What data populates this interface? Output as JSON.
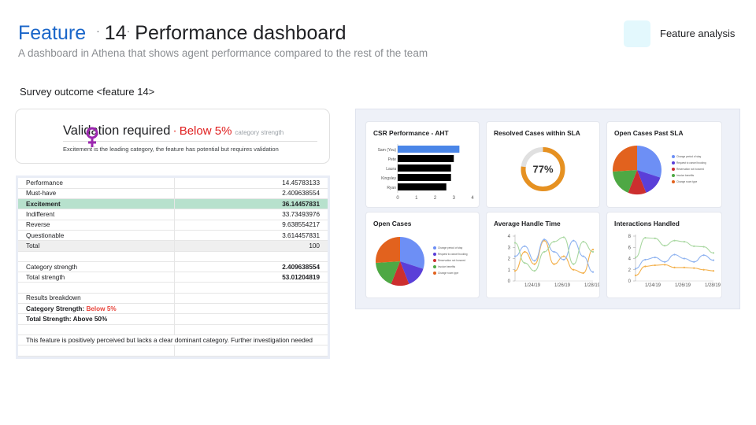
{
  "header": {
    "title_feature": "Feature",
    "title_sep": "·",
    "title_number": "14",
    "title_sep2": "·",
    "title_rest": "Performance dashboard",
    "subtitle": "A dashboard in Athena that shows agent performance compared to the rest of the team"
  },
  "tag": {
    "label": "Feature analysis",
    "color": "#e3f8fd"
  },
  "section_label": "Survey outcome <feature 14>",
  "validation": {
    "heading": "Validation required",
    "dot": "·",
    "below": "Below 5%",
    "small": "category strength",
    "description": "Excitement is the leading category, the feature has potential but requires validation",
    "icon": "female-symbol-icon",
    "icon_color": "#9c27b0"
  },
  "sheet": {
    "rows": [
      {
        "label": "Performance",
        "value": "14.45783133"
      },
      {
        "label": "Must-have",
        "value": "2.409638554"
      },
      {
        "label": "Excitement",
        "value": "36.14457831",
        "highlight": true
      },
      {
        "label": "Indifferent",
        "value": "33.73493976"
      },
      {
        "label": "Reverse",
        "value": "9.638554217"
      },
      {
        "label": "Questionable",
        "value": "3.614457831"
      },
      {
        "label": "Total",
        "value": "100",
        "total": true
      },
      {
        "label": "",
        "value": ""
      },
      {
        "label": "Category strength",
        "value": "2.409638554",
        "bold_value": true
      },
      {
        "label": "Total strength",
        "value": "53.01204819",
        "bold_value": true
      },
      {
        "label": "",
        "value": ""
      },
      {
        "label": "Results breakdown",
        "value": ""
      },
      {
        "label": "Category Strength: ",
        "label_red": "Below 5%",
        "value": "",
        "bold": true
      },
      {
        "label": "Total Strength: Above 50%",
        "value": "",
        "bold": true
      },
      {
        "label": "",
        "value": ""
      },
      {
        "label": "This feature is positively perceived but lacks a clear dominant category. Further investigation needed",
        "value": "",
        "full": true
      },
      {
        "label": "",
        "value": ""
      }
    ]
  },
  "dashboard": {
    "cards": [
      {
        "title": "CSR Performance - AHT"
      },
      {
        "title": "Resolved Cases within SLA"
      },
      {
        "title": "Open Cases Past SLA"
      },
      {
        "title": "Open Cases"
      },
      {
        "title": "Average Handle Time"
      },
      {
        "title": "Interactions Handled"
      }
    ],
    "aht": {
      "agents": [
        "Sam (You)",
        "Pete",
        "Laura",
        "Kingsley",
        "Ryan"
      ],
      "values": [
        3.3,
        3.0,
        2.85,
        2.85,
        2.6
      ],
      "ticks": [
        "0",
        "1",
        "2",
        "3",
        "4"
      ],
      "max": 4,
      "colors": [
        "#4a86e8",
        "#000000",
        "#000000",
        "#000000",
        "#000000"
      ]
    },
    "sla": {
      "percent": 77,
      "label": "77%",
      "color": "#e69121",
      "track": "#e0e0e0"
    },
    "pie_legend": [
      "Change period of stay",
      "Request to cancel booking",
      "Reservation not honored",
      "Invoice benefits",
      "Change room type"
    ],
    "pie_past_sla": {
      "values": [
        30,
        14,
        12,
        18,
        26
      ],
      "colors": [
        "#6d8ff5",
        "#5a3fd8",
        "#cc2f2f",
        "#4ea844",
        "#e2621e"
      ]
    },
    "pie_open": {
      "values": [
        30,
        14,
        12,
        18,
        26
      ],
      "colors": [
        "#6d8ff5",
        "#5a3fd8",
        "#cc2f2f",
        "#4ea844",
        "#e2621e"
      ]
    },
    "aht_line": {
      "yticks": [
        "0",
        "1",
        "2",
        "3",
        "4"
      ],
      "xticks": [
        "1/24/19",
        "1/26/19",
        "1/28/19"
      ],
      "series": [
        {
          "color": "#f3b04b",
          "values": [
            0.9,
            2.6,
            1.5,
            3.6,
            1.5,
            2.2,
            1.0,
            0.7,
            2.8
          ]
        },
        {
          "color": "#8fb3f0",
          "values": [
            2.2,
            3.1,
            1.8,
            3.7,
            2.6,
            1.9,
            3.6,
            2.2,
            0.8
          ]
        },
        {
          "color": "#a8d7a0",
          "values": [
            3.4,
            1.6,
            0.9,
            2.6,
            3.5,
            3.9,
            1.5,
            3.5,
            2.6
          ]
        }
      ]
    },
    "interactions_line": {
      "yticks": [
        "0",
        "2",
        "4",
        "6",
        "8"
      ],
      "xticks": [
        "1/24/19",
        "1/26/19",
        "1/28/19"
      ],
      "series": [
        {
          "color": "#a8d7a0",
          "values": [
            4.2,
            7.7,
            7.6,
            6.3,
            7.2,
            7.0,
            6.2,
            6.1,
            5.0
          ]
        },
        {
          "color": "#8fb3f0",
          "values": [
            2.2,
            3.8,
            4.2,
            3.4,
            4.7,
            4.0,
            3.4,
            4.6,
            3.7
          ]
        },
        {
          "color": "#f3b04b",
          "values": [
            1.0,
            2.6,
            2.8,
            2.9,
            2.4,
            2.4,
            2.3,
            2.0,
            1.8
          ]
        }
      ]
    }
  }
}
